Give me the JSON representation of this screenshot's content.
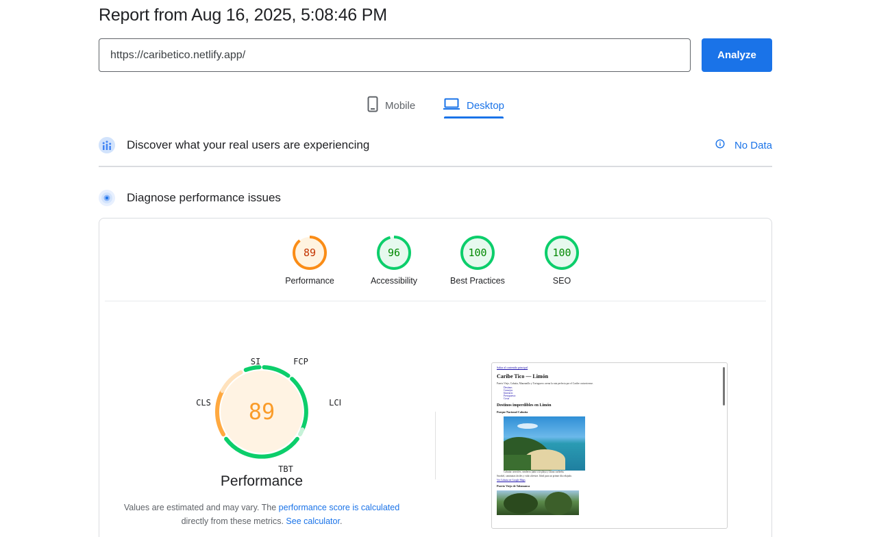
{
  "report_title": "Report from Aug 16, 2025, 5:08:46 PM",
  "url_input": {
    "value": "https://caribetico.netlify.app/"
  },
  "analyze_label": "Analyze",
  "tabs": {
    "mobile": "Mobile",
    "desktop": "Desktop",
    "active": "desktop"
  },
  "field_data": {
    "title": "Discover what your real users are experiencing",
    "status": "No Data"
  },
  "lab_data": {
    "title": "Diagnose performance issues"
  },
  "scores": [
    {
      "label": "Performance",
      "value": "89",
      "level": "average",
      "color": "#fa8c16"
    },
    {
      "label": "Accessibility",
      "value": "96",
      "level": "pass",
      "color": "#0cce6b"
    },
    {
      "label": "Best Practices",
      "value": "100",
      "level": "pass",
      "color": "#0cce6b"
    },
    {
      "label": "SEO",
      "value": "100",
      "level": "pass",
      "color": "#0cce6b"
    }
  ],
  "performance_detail": {
    "score": "89",
    "title": "Performance",
    "metrics": {
      "si": "SI",
      "fcp": "FCP",
      "lcp": "LCP",
      "tbt": "TBT",
      "cls": "CLS"
    },
    "note_prefix": "Values are estimated and may vary. The",
    "note_link1": "performance score is calculated",
    "note_mid": "directly from these metrics.",
    "note_link2": "See calculator",
    "note_suffix": "."
  },
  "screenshot": {
    "skip_link": "Saltar al contenido principal",
    "heading": "Caribe Tico — Limón",
    "lead": "Puerto Viejo, Cahuita, Manzanillo y Tortuguero: arena la ruta perfecta por el Caribe costarricense.",
    "nav": [
      "Destinos",
      "Consejos",
      "Itinerario",
      "Presupuesto",
      "Costa"
    ],
    "section_heading": "Destinos imperdibles en Limón",
    "dest1_title": "Parque Nacional Cahuita",
    "dest1_caption": "Cahuita: arrecifes, senderos junto a la playa y fauna caribeña.",
    "dest1_desc": "Snorkel, caminatas fáciles y vida silvestre. Ideal para un primer día relajado.",
    "dest1_link": "Ver Cahuita en Google Maps",
    "dest2_title": "Puerto Viejo de Talamanca"
  },
  "colors": {
    "accent": "#1a73e8",
    "pass": "#0cce6b",
    "average": "#fa8c16"
  }
}
